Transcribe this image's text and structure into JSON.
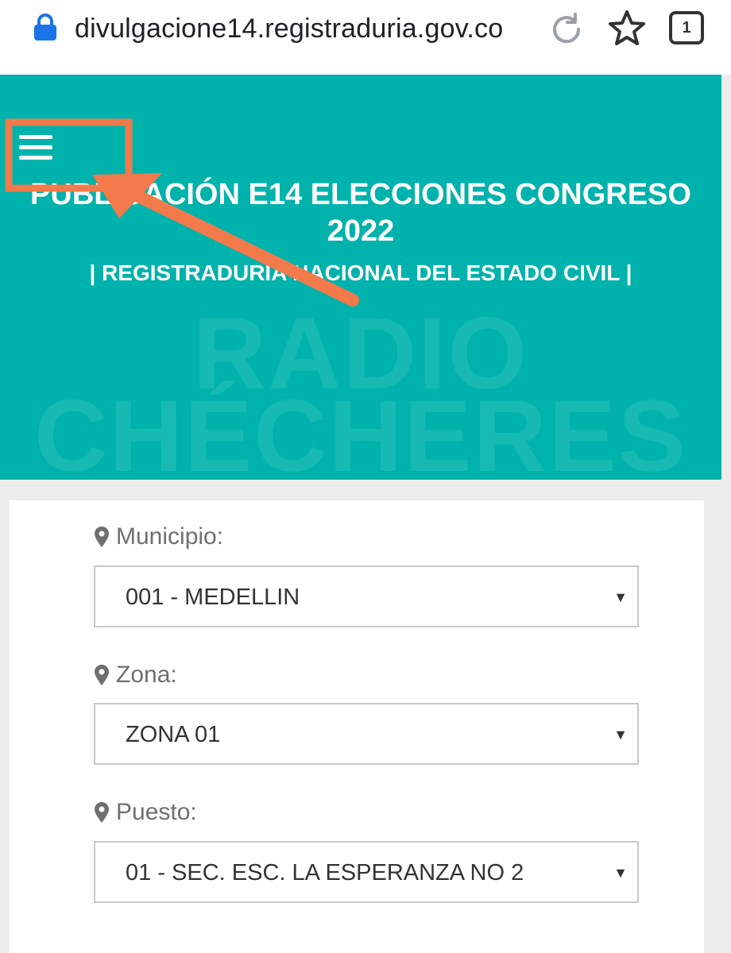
{
  "browser": {
    "url": "divulgacione14.registraduria.gov.co",
    "tab_count": "1",
    "icons": {
      "lock": "lock-icon",
      "reload": "reload-icon",
      "bookmark": "star-icon"
    },
    "accent_color": "#1a73e8"
  },
  "header": {
    "title": "PUBLICACIÓN E14 ELECCIONES CONGRESO 2022",
    "subtitle": "| REGISTRADURÍA NACIONAL DEL ESTADO CIVIL |",
    "watermark_line1": "RADIO",
    "watermark_line2": "CHÉCHERES",
    "background_color": "#00b2ac",
    "menu_icon": "hamburger-menu-icon"
  },
  "annotation": {
    "highlight_color": "#f37a4b"
  },
  "form": {
    "fields": [
      {
        "label": "Municipio:",
        "value": "001 - MEDELLIN"
      },
      {
        "label": "Zona:",
        "value": "ZONA 01"
      },
      {
        "label": "Puesto:",
        "value": "01 - SEC. ESC. LA ESPERANZA NO 2"
      }
    ],
    "field_icon": "map-pin-icon",
    "dropdown_icon": "caret-down-icon"
  }
}
